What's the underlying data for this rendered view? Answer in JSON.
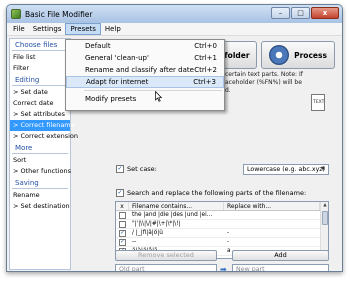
{
  "window": {
    "title": "Basic File Modifier",
    "controls": {
      "minimize": "–",
      "maximize": "□",
      "close": "x"
    }
  },
  "menubar": {
    "items": [
      "File",
      "Settings",
      "Presets",
      "Help"
    ]
  },
  "presets_menu": {
    "items": [
      {
        "label": "Default",
        "shortcut": "Ctrl+0"
      },
      {
        "label": "General 'clean-up'",
        "shortcut": "Ctrl+1"
      },
      {
        "label": "Rename and classify after date",
        "shortcut": "Ctrl+2"
      },
      {
        "label": "Adapt for internet",
        "shortcut": "Ctrl+3"
      },
      {
        "label": "Modify presets",
        "shortcut": ""
      }
    ]
  },
  "sidebar": {
    "choose_title": "Choose files",
    "choose_items": [
      "File list",
      "Filter"
    ],
    "editing_title": "Editing",
    "editing_items": [
      "> Set date",
      "Correct date",
      "> Set attributes",
      "> Correct filename",
      "> Correct extension"
    ],
    "more_title": "More",
    "more_items": [
      "Sort",
      "> Other functions"
    ],
    "saving_title": "Saving",
    "saving_items": [
      "Rename",
      "> Set destination"
    ]
  },
  "main": {
    "folder_button": "folder",
    "process_button": "Process",
    "description_line1": "certain text parts. Note: If",
    "description_line2": "aceholder (%FN%) will be",
    "description_line3": "d.",
    "doc_icon_text": "TEXT",
    "set_case_label": "Set case:",
    "set_case_value": "Lowercase  (e.g. abc.xyz)",
    "search_replace_label": "Search and replace the following parts of the filename:",
    "table": {
      "headers": [
        "x",
        "Filename contains...",
        "Replace with..."
      ],
      "rows": [
        {
          "checked": false,
          "contains": "the |and |die |des |und |ei...",
          "replace": ""
        },
        {
          "checked": false,
          "contains": "\"|'|\\\\|\\/|#|\\+|\\*|\\!|",
          "replace": ""
        },
        {
          "checked": true,
          "contains": "/ |_|fi|ä|ö|ü",
          "replace": "-"
        },
        {
          "checked": true,
          "contains": "--",
          "replace": "-"
        },
        {
          "checked": true,
          "contains": "ä|à|á|â|ã",
          "replace": "a"
        }
      ]
    },
    "old_part_placeholder": "Old part",
    "new_part_placeholder": "New part",
    "remove_selected": "Remove selected",
    "add": "Add"
  }
}
